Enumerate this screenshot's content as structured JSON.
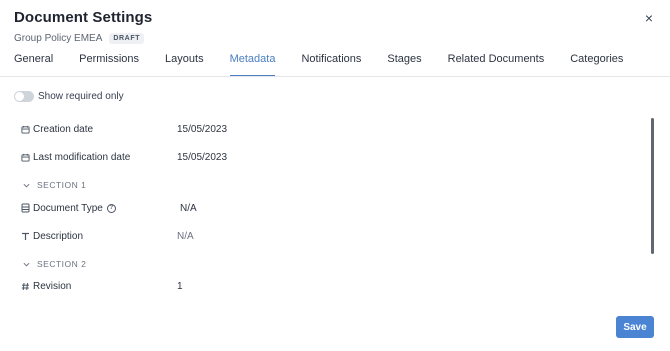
{
  "header": {
    "title": "Document Settings",
    "subtitle": "Group Policy EMEA",
    "badge": "DRAFT",
    "close_glyph": "×"
  },
  "tabs": [
    {
      "label": "General",
      "active": false
    },
    {
      "label": "Permissions",
      "active": false
    },
    {
      "label": "Layouts",
      "active": false
    },
    {
      "label": "Metadata",
      "active": true
    },
    {
      "label": "Notifications",
      "active": false
    },
    {
      "label": "Stages",
      "active": false
    },
    {
      "label": "Related Documents",
      "active": false
    },
    {
      "label": "Categories",
      "active": false
    }
  ],
  "filter": {
    "toggle_label": "Show required only",
    "toggle_on": false
  },
  "fields": {
    "creation_date": {
      "label": "Creation date",
      "value": "15/05/2023",
      "icon": "calendar-icon"
    },
    "last_modification_date": {
      "label": "Last modification date",
      "value": "15/05/2023",
      "icon": "calendar-icon"
    },
    "section_1": {
      "label": "SECTION 1"
    },
    "document_type": {
      "label": "Document Type",
      "value": "N/A",
      "icon": "list-icon",
      "help": "?"
    },
    "description": {
      "label": "Description",
      "value": "N/A",
      "icon": "text-icon"
    },
    "section_2": {
      "label": "SECTION 2"
    },
    "revision": {
      "label": "Revision",
      "value": "1",
      "icon": "hash-icon"
    }
  },
  "actions": {
    "save_label": "Save"
  },
  "colors": {
    "accent": "#4a7fc1",
    "save_button": "#4a84d3"
  }
}
